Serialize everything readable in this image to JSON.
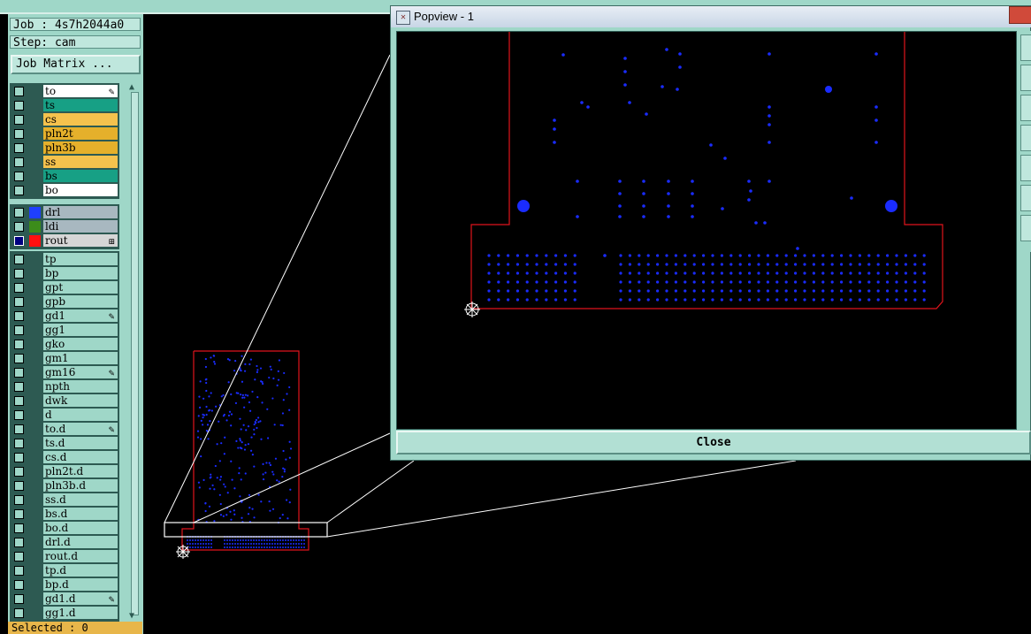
{
  "info": {
    "job": "Job : 4s7h2044a0",
    "step": "Step: cam",
    "job_matrix": "Job Matrix ..."
  },
  "layers_top": [
    {
      "name": "to",
      "color": "#ffffff",
      "edit": true
    },
    {
      "name": "ts",
      "color": "#17a085",
      "edit": false
    },
    {
      "name": "cs",
      "color": "#f5c24d",
      "edit": false
    },
    {
      "name": "pln2t",
      "color": "#e5b02b",
      "edit": false
    },
    {
      "name": "pln3b",
      "color": "#e5b02b",
      "edit": false
    },
    {
      "name": "ss",
      "color": "#f5c24d",
      "edit": false
    },
    {
      "name": "bs",
      "color": "#17a085",
      "edit": false
    },
    {
      "name": "bo",
      "color": "#ffffff",
      "edit": false
    }
  ],
  "layers_drill": [
    {
      "name": "drl",
      "swatch": "#1f3fff",
      "color": "#a8b8c0",
      "edit": false,
      "active": false
    },
    {
      "name": "ldi",
      "swatch": "#3c8c1a",
      "color": "#a8b8c0",
      "edit": false,
      "active": false
    },
    {
      "name": "rout",
      "swatch": "#ff1010",
      "color": "#d6d6d6",
      "edit": false,
      "active": true
    }
  ],
  "layers_misc": [
    {
      "name": "tp",
      "edit": false
    },
    {
      "name": "bp",
      "edit": false
    },
    {
      "name": "gpt",
      "edit": false
    },
    {
      "name": "gpb",
      "edit": false
    },
    {
      "name": "gd1",
      "edit": true
    },
    {
      "name": "gg1",
      "edit": false
    },
    {
      "name": "gko",
      "edit": false
    },
    {
      "name": "gm1",
      "edit": false
    },
    {
      "name": "gm16",
      "edit": true
    },
    {
      "name": "npth",
      "edit": false
    },
    {
      "name": "dwk",
      "edit": false
    },
    {
      "name": "d",
      "edit": false
    },
    {
      "name": "to.d",
      "edit": true
    },
    {
      "name": "ts.d",
      "edit": false
    },
    {
      "name": "cs.d",
      "edit": false
    },
    {
      "name": "pln2t.d",
      "edit": false
    },
    {
      "name": "pln3b.d",
      "edit": false
    },
    {
      "name": "ss.d",
      "edit": false
    },
    {
      "name": "bs.d",
      "edit": false
    },
    {
      "name": "bo.d",
      "edit": false
    },
    {
      "name": "drl.d",
      "edit": false
    },
    {
      "name": "rout.d",
      "edit": false
    },
    {
      "name": "tp.d",
      "edit": false
    },
    {
      "name": "bp.d",
      "edit": false
    },
    {
      "name": "gd1.d",
      "edit": true
    },
    {
      "name": "gg1.d",
      "edit": false
    }
  ],
  "misc_color": "#9fd7c8",
  "status": {
    "selected": "Selected : 0"
  },
  "popview": {
    "title": "Popview - 1",
    "close_label": "Close"
  },
  "colors": {
    "pad": "#1a2cff",
    "outline": "#e0141c",
    "zoom_box": "#ffffff",
    "panel": "#9fd7c8"
  }
}
